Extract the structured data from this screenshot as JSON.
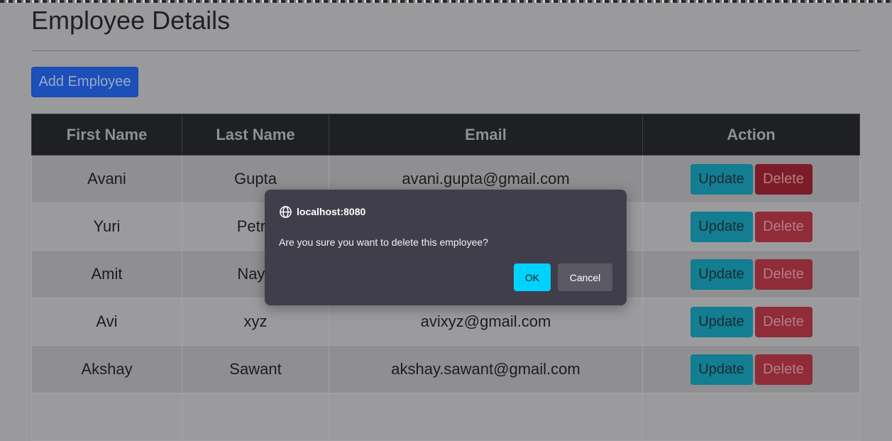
{
  "page": {
    "title": "Employee Details",
    "add_button_label": "Add Employee"
  },
  "table": {
    "headers": [
      "First Name",
      "Last Name",
      "Email",
      "Action"
    ],
    "rows": [
      {
        "first_name": "Avani",
        "last_name": "Gupta",
        "email": "avani.gupta@gmail.com"
      },
      {
        "first_name": "Yuri",
        "last_name": "Petro",
        "email": ""
      },
      {
        "first_name": "Amit",
        "last_name": "Naya",
        "email": ""
      },
      {
        "first_name": "Avi",
        "last_name": "xyz",
        "email": "avixyz@gmail.com"
      },
      {
        "first_name": "Akshay",
        "last_name": "Sawant",
        "email": "akshay.sawant@gmail.com"
      }
    ],
    "update_label": "Update",
    "delete_label": "Delete"
  },
  "dialog": {
    "origin": "localhost:8080",
    "message": "Are you sure you want to delete this employee?",
    "ok_label": "OK",
    "cancel_label": "Cancel",
    "origin_icon": "globe-icon"
  },
  "colors": {
    "primary": "#1d4fb8",
    "info": "#137d91",
    "danger": "#8f2c38",
    "dialog_bg": "#413e4c",
    "ok_accent": "#00d2ff"
  }
}
